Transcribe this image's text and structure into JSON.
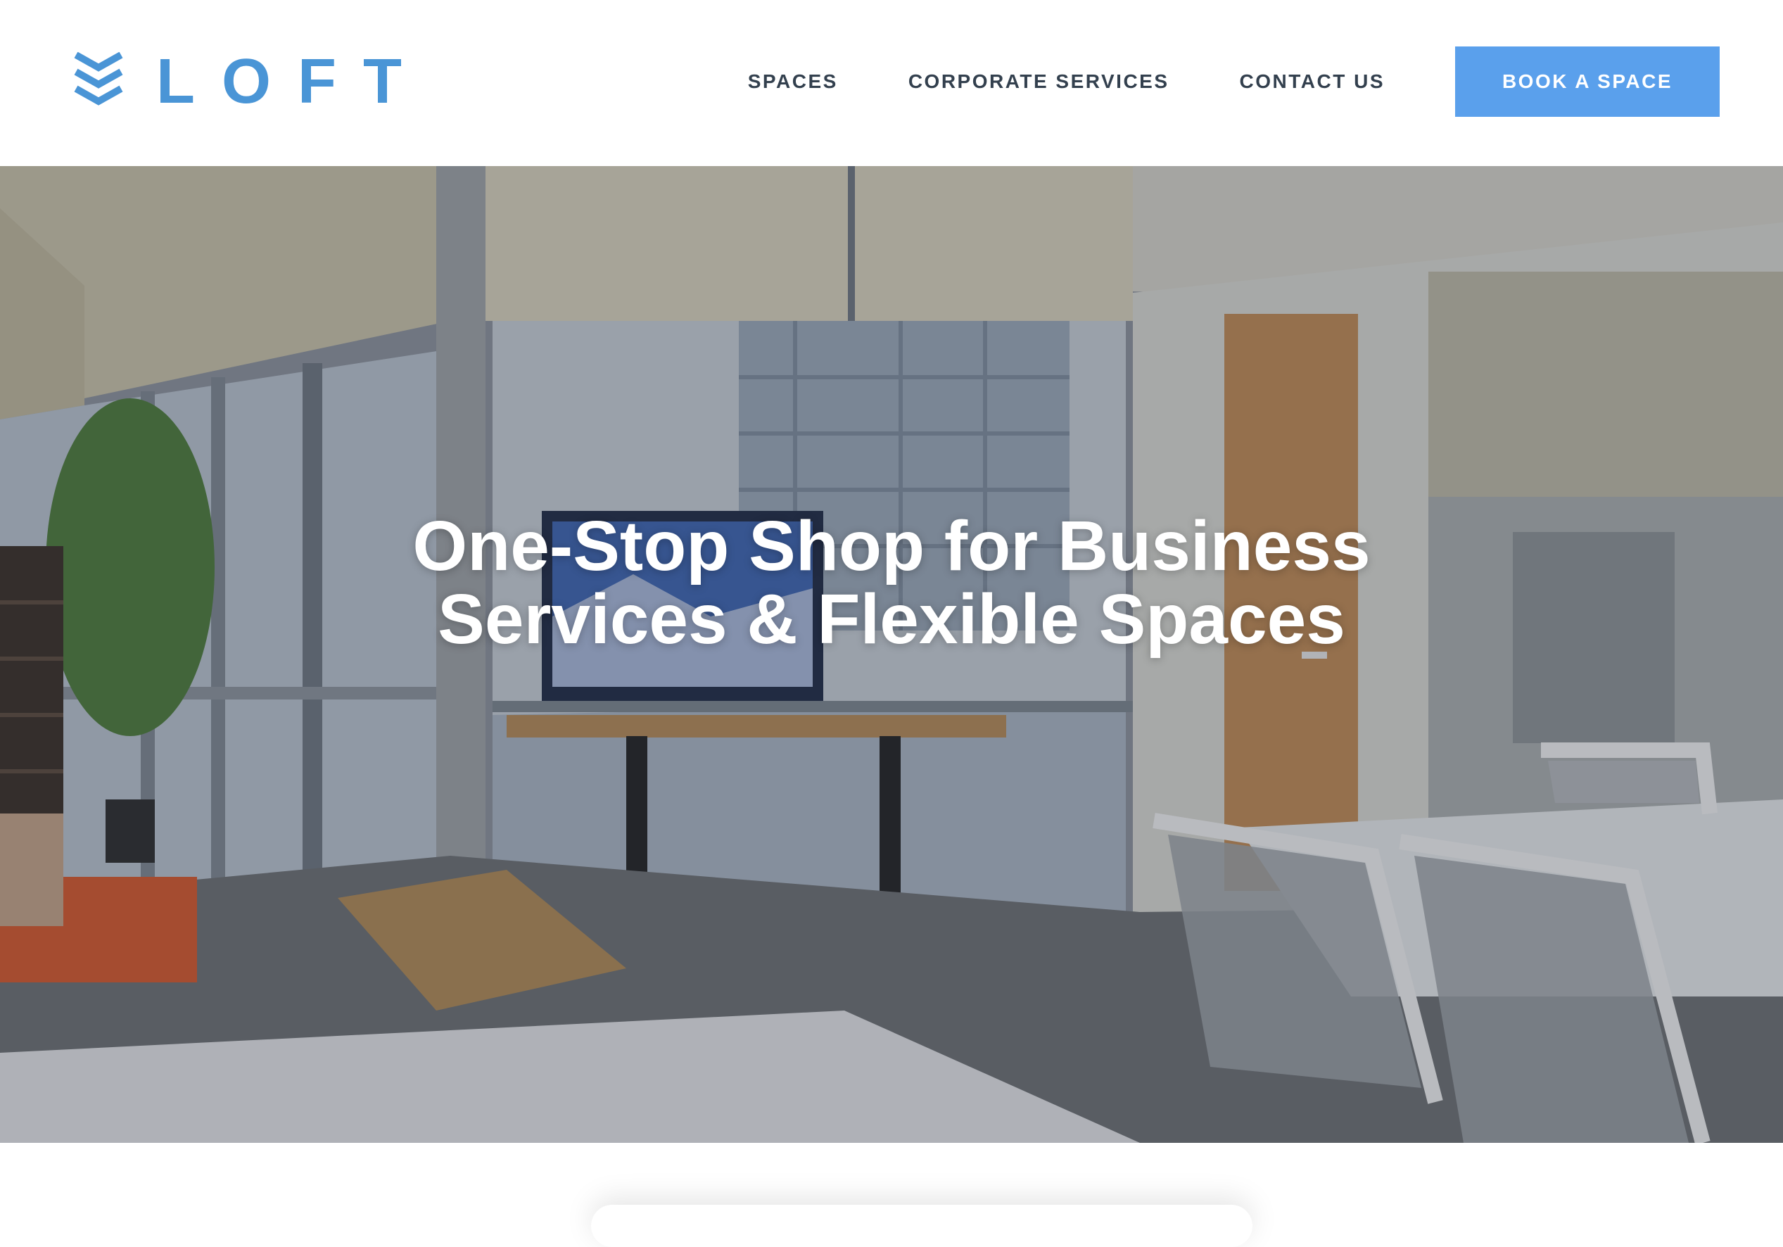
{
  "brand": {
    "logo_text": "LOFT",
    "logo_icon": "triple-chevron-down-icon",
    "accent_color": "#4a95d6"
  },
  "nav": {
    "links": [
      {
        "label": "SPACES"
      },
      {
        "label": "CORPORATE SERVICES"
      },
      {
        "label": "CONTACT US"
      }
    ],
    "cta_label": "BOOK A SPACE",
    "cta_color": "#5aa0ec"
  },
  "hero": {
    "title_line1": "One-Stop Shop for Business",
    "title_line2": "Services & Flexible Spaces"
  }
}
